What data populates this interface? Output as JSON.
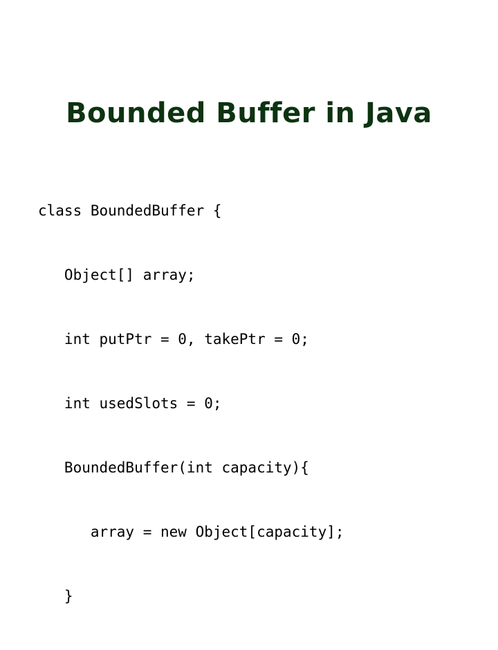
{
  "slide": {
    "title": "Bounded Buffer in Java",
    "title_color": "#0d3311",
    "background_color": "#ffffff",
    "code_color": "#000000",
    "code": {
      "language": "java",
      "lines": [
        "class BoundedBuffer {",
        "   Object[] array;",
        "   int putPtr = 0, takePtr = 0;",
        "   int usedSlots = 0;",
        "   BoundedBuffer(int capacity){",
        "      array = new Object[capacity];",
        "   }"
      ]
    }
  }
}
